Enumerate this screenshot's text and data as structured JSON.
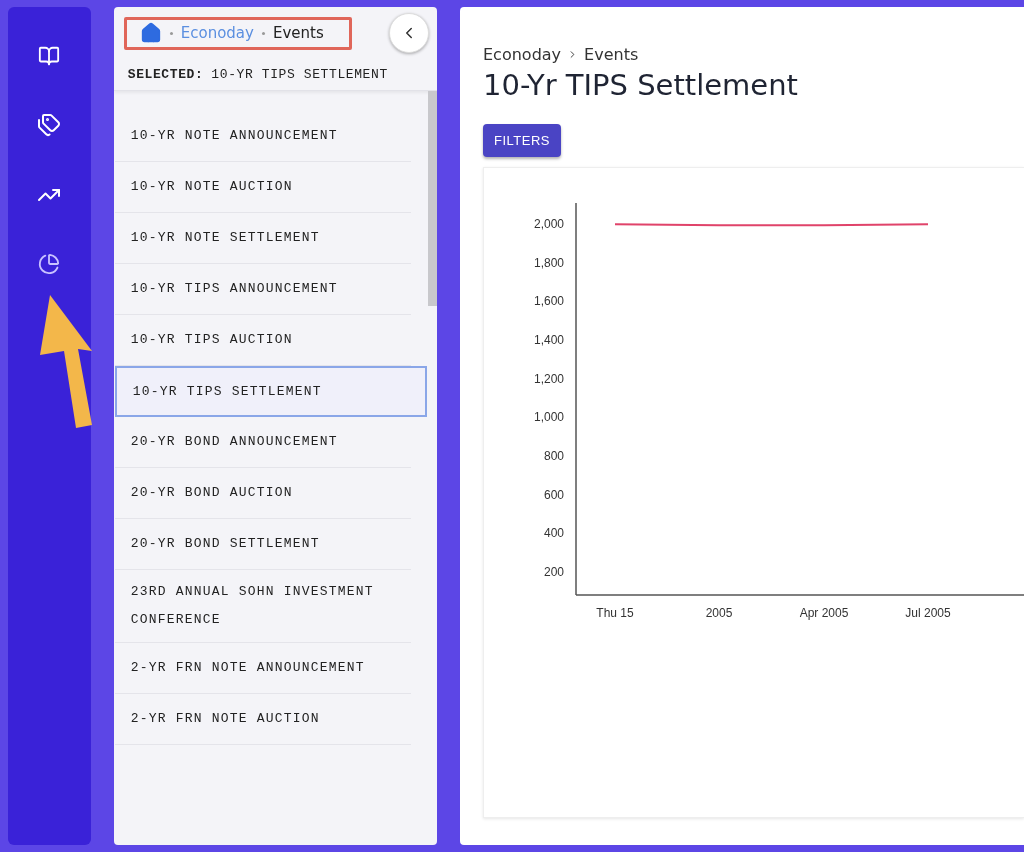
{
  "sidebar": {
    "breadcrumb": [
      {
        "label": "Econoday",
        "kind": "link"
      },
      {
        "label": "Events",
        "kind": "current"
      }
    ],
    "selected_label": "SELECTED:",
    "selected_value": "10-YR TIPS SETTLEMENT",
    "items": [
      {
        "label": "10-YR NOTE ANNOUNCEMENT",
        "selected": false
      },
      {
        "label": "10-YR NOTE AUCTION",
        "selected": false
      },
      {
        "label": "10-YR NOTE SETTLEMENT",
        "selected": false
      },
      {
        "label": "10-YR TIPS ANNOUNCEMENT",
        "selected": false
      },
      {
        "label": "10-YR TIPS AUCTION",
        "selected": false
      },
      {
        "label": "10-YR TIPS SETTLEMENT",
        "selected": true
      },
      {
        "label": "20-YR BOND ANNOUNCEMENT",
        "selected": false
      },
      {
        "label": "20-YR BOND AUCTION",
        "selected": false
      },
      {
        "label": "20-YR BOND SETTLEMENT",
        "selected": false
      },
      {
        "label": "23RD ANNUAL SOHN INVESTMENT CONFERENCE",
        "selected": false
      },
      {
        "label": "2-YR FRN NOTE ANNOUNCEMENT",
        "selected": false
      },
      {
        "label": "2-YR FRN NOTE AUCTION",
        "selected": false
      }
    ]
  },
  "main": {
    "breadcrumb": [
      "Econoday",
      "Events"
    ],
    "title": "10-Yr TIPS Settlement",
    "filters_button": "FILTERS",
    "chart_data": {
      "type": "line",
      "categories": [
        "Thu 15",
        "2005",
        "Apr 2005",
        "Jul 2005"
      ],
      "ylim": [
        80,
        2110
      ],
      "yticks": [
        200,
        400,
        600,
        800,
        {
          "value": 1000,
          "label": "1,000"
        },
        {
          "value": 1200,
          "label": "1,200"
        },
        {
          "value": 1400,
          "label": "1,400"
        },
        {
          "value": 1600,
          "label": "1,600"
        },
        {
          "value": 1800,
          "label": "1,800"
        },
        {
          "value": 2000,
          "label": "2,000"
        }
      ],
      "series": [
        {
          "color": "#e0436a",
          "values": [
            2000,
            1995,
            1995,
            2000
          ]
        }
      ]
    }
  },
  "annotations": {
    "breadcrumb_highlight": true,
    "arrow_to_rail_icon": true
  }
}
